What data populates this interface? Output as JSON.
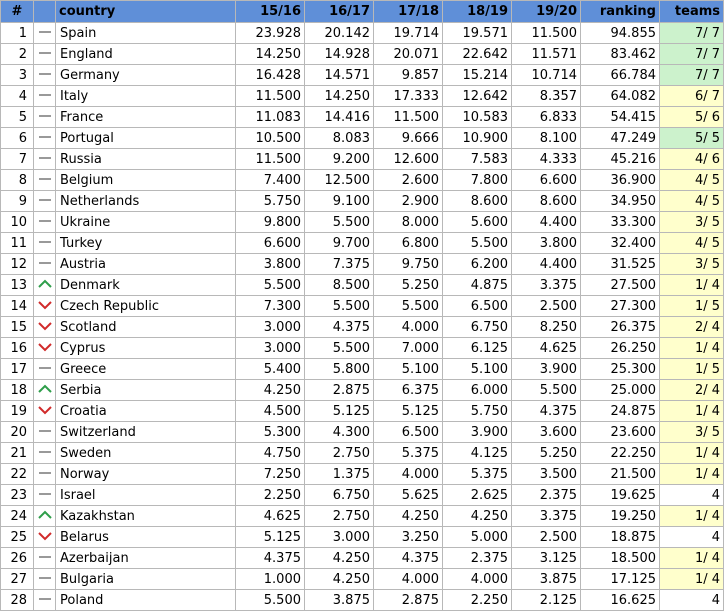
{
  "headers": {
    "index": "#",
    "country": "country",
    "s1516": "15/16",
    "s1617": "16/17",
    "s1718": "17/18",
    "s1819": "18/19",
    "s1920": "19/20",
    "ranking": "ranking",
    "teams": "teams"
  },
  "colors": {
    "header_bg": "#5f8fd8",
    "teams_all_remaining": "#ccf2cc",
    "teams_partial": "#ffffcc",
    "teams_none": "#ffffff",
    "trend_up": "#2e9e4a",
    "trend_down": "#d12a2a",
    "trend_same": "#999999"
  },
  "rows": [
    {
      "idx": "1",
      "trend": "same",
      "country": "Spain",
      "s1516": "23.928",
      "s1617": "20.142",
      "s1718": "19.714",
      "s1819": "19.571",
      "s1920": "11.500",
      "ranking": "94.855",
      "teams": "7/ 7",
      "tc": "g"
    },
    {
      "idx": "2",
      "trend": "same",
      "country": "England",
      "s1516": "14.250",
      "s1617": "14.928",
      "s1718": "20.071",
      "s1819": "22.642",
      "s1920": "11.571",
      "ranking": "83.462",
      "teams": "7/ 7",
      "tc": "g"
    },
    {
      "idx": "3",
      "trend": "same",
      "country": "Germany",
      "s1516": "16.428",
      "s1617": "14.571",
      "s1718": "9.857",
      "s1819": "15.214",
      "s1920": "10.714",
      "ranking": "66.784",
      "teams": "7/ 7",
      "tc": "g"
    },
    {
      "idx": "4",
      "trend": "same",
      "country": "Italy",
      "s1516": "11.500",
      "s1617": "14.250",
      "s1718": "17.333",
      "s1819": "12.642",
      "s1920": "8.357",
      "ranking": "64.082",
      "teams": "6/ 7",
      "tc": "y"
    },
    {
      "idx": "5",
      "trend": "same",
      "country": "France",
      "s1516": "11.083",
      "s1617": "14.416",
      "s1718": "11.500",
      "s1819": "10.583",
      "s1920": "6.833",
      "ranking": "54.415",
      "teams": "5/ 6",
      "tc": "y"
    },
    {
      "idx": "6",
      "trend": "same",
      "country": "Portugal",
      "s1516": "10.500",
      "s1617": "8.083",
      "s1718": "9.666",
      "s1819": "10.900",
      "s1920": "8.100",
      "ranking": "47.249",
      "teams": "5/ 5",
      "tc": "g"
    },
    {
      "idx": "7",
      "trend": "same",
      "country": "Russia",
      "s1516": "11.500",
      "s1617": "9.200",
      "s1718": "12.600",
      "s1819": "7.583",
      "s1920": "4.333",
      "ranking": "45.216",
      "teams": "4/ 6",
      "tc": "y"
    },
    {
      "idx": "8",
      "trend": "same",
      "country": "Belgium",
      "s1516": "7.400",
      "s1617": "12.500",
      "s1718": "2.600",
      "s1819": "7.800",
      "s1920": "6.600",
      "ranking": "36.900",
      "teams": "4/ 5",
      "tc": "y"
    },
    {
      "idx": "9",
      "trend": "same",
      "country": "Netherlands",
      "s1516": "5.750",
      "s1617": "9.100",
      "s1718": "2.900",
      "s1819": "8.600",
      "s1920": "8.600",
      "ranking": "34.950",
      "teams": "4/ 5",
      "tc": "y"
    },
    {
      "idx": "10",
      "trend": "same",
      "country": "Ukraine",
      "s1516": "9.800",
      "s1617": "5.500",
      "s1718": "8.000",
      "s1819": "5.600",
      "s1920": "4.400",
      "ranking": "33.300",
      "teams": "3/ 5",
      "tc": "y"
    },
    {
      "idx": "11",
      "trend": "same",
      "country": "Turkey",
      "s1516": "6.600",
      "s1617": "9.700",
      "s1718": "6.800",
      "s1819": "5.500",
      "s1920": "3.800",
      "ranking": "32.400",
      "teams": "4/ 5",
      "tc": "y"
    },
    {
      "idx": "12",
      "trend": "same",
      "country": "Austria",
      "s1516": "3.800",
      "s1617": "7.375",
      "s1718": "9.750",
      "s1819": "6.200",
      "s1920": "4.400",
      "ranking": "31.525",
      "teams": "3/ 5",
      "tc": "y"
    },
    {
      "idx": "13",
      "trend": "up",
      "country": "Denmark",
      "s1516": "5.500",
      "s1617": "8.500",
      "s1718": "5.250",
      "s1819": "4.875",
      "s1920": "3.375",
      "ranking": "27.500",
      "teams": "1/ 4",
      "tc": "y"
    },
    {
      "idx": "14",
      "trend": "down",
      "country": "Czech Republic",
      "s1516": "7.300",
      "s1617": "5.500",
      "s1718": "5.500",
      "s1819": "6.500",
      "s1920": "2.500",
      "ranking": "27.300",
      "teams": "1/ 5",
      "tc": "y"
    },
    {
      "idx": "15",
      "trend": "down",
      "country": "Scotland",
      "s1516": "3.000",
      "s1617": "4.375",
      "s1718": "4.000",
      "s1819": "6.750",
      "s1920": "8.250",
      "ranking": "26.375",
      "teams": "2/ 4",
      "tc": "y"
    },
    {
      "idx": "16",
      "trend": "down",
      "country": "Cyprus",
      "s1516": "3.000",
      "s1617": "5.500",
      "s1718": "7.000",
      "s1819": "6.125",
      "s1920": "4.625",
      "ranking": "26.250",
      "teams": "1/ 4",
      "tc": "y"
    },
    {
      "idx": "17",
      "trend": "same",
      "country": "Greece",
      "s1516": "5.400",
      "s1617": "5.800",
      "s1718": "5.100",
      "s1819": "5.100",
      "s1920": "3.900",
      "ranking": "25.300",
      "teams": "1/ 5",
      "tc": "y"
    },
    {
      "idx": "18",
      "trend": "up",
      "country": "Serbia",
      "s1516": "4.250",
      "s1617": "2.875",
      "s1718": "6.375",
      "s1819": "6.000",
      "s1920": "5.500",
      "ranking": "25.000",
      "teams": "2/ 4",
      "tc": "y"
    },
    {
      "idx": "19",
      "trend": "down",
      "country": "Croatia",
      "s1516": "4.500",
      "s1617": "5.125",
      "s1718": "5.125",
      "s1819": "5.750",
      "s1920": "4.375",
      "ranking": "24.875",
      "teams": "1/ 4",
      "tc": "y"
    },
    {
      "idx": "20",
      "trend": "same",
      "country": "Switzerland",
      "s1516": "5.300",
      "s1617": "4.300",
      "s1718": "6.500",
      "s1819": "3.900",
      "s1920": "3.600",
      "ranking": "23.600",
      "teams": "3/ 5",
      "tc": "y"
    },
    {
      "idx": "21",
      "trend": "same",
      "country": "Sweden",
      "s1516": "4.750",
      "s1617": "2.750",
      "s1718": "5.375",
      "s1819": "4.125",
      "s1920": "5.250",
      "ranking": "22.250",
      "teams": "1/ 4",
      "tc": "y"
    },
    {
      "idx": "22",
      "trend": "same",
      "country": "Norway",
      "s1516": "7.250",
      "s1617": "1.375",
      "s1718": "4.000",
      "s1819": "5.375",
      "s1920": "3.500",
      "ranking": "21.500",
      "teams": "1/ 4",
      "tc": "y"
    },
    {
      "idx": "23",
      "trend": "same",
      "country": "Israel",
      "s1516": "2.250",
      "s1617": "6.750",
      "s1718": "5.625",
      "s1819": "2.625",
      "s1920": "2.375",
      "ranking": "19.625",
      "teams": "4",
      "tc": "w"
    },
    {
      "idx": "24",
      "trend": "up",
      "country": "Kazakhstan",
      "s1516": "4.625",
      "s1617": "2.750",
      "s1718": "4.250",
      "s1819": "4.250",
      "s1920": "3.375",
      "ranking": "19.250",
      "teams": "1/ 4",
      "tc": "y"
    },
    {
      "idx": "25",
      "trend": "down",
      "country": "Belarus",
      "s1516": "5.125",
      "s1617": "3.000",
      "s1718": "3.250",
      "s1819": "5.000",
      "s1920": "2.500",
      "ranking": "18.875",
      "teams": "4",
      "tc": "w"
    },
    {
      "idx": "26",
      "trend": "same",
      "country": "Azerbaijan",
      "s1516": "4.375",
      "s1617": "4.250",
      "s1718": "4.375",
      "s1819": "2.375",
      "s1920": "3.125",
      "ranking": "18.500",
      "teams": "1/ 4",
      "tc": "y"
    },
    {
      "idx": "27",
      "trend": "same",
      "country": "Bulgaria",
      "s1516": "1.000",
      "s1617": "4.250",
      "s1718": "4.000",
      "s1819": "4.000",
      "s1920": "3.875",
      "ranking": "17.125",
      "teams": "1/ 4",
      "tc": "y"
    },
    {
      "idx": "28",
      "trend": "same",
      "country": "Poland",
      "s1516": "5.500",
      "s1617": "3.875",
      "s1718": "2.875",
      "s1819": "2.250",
      "s1920": "2.125",
      "ranking": "16.625",
      "teams": "4",
      "tc": "w"
    }
  ]
}
